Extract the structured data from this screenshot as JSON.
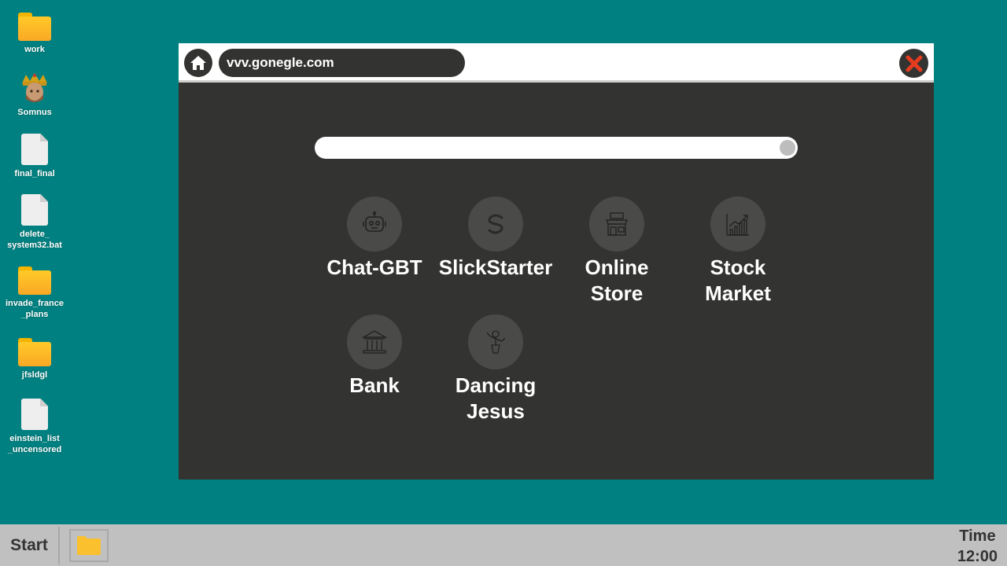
{
  "desktop": {
    "icons": [
      {
        "label": "work",
        "type": "folder"
      },
      {
        "label": "Somnus",
        "type": "app"
      },
      {
        "label": "final_final",
        "type": "file"
      },
      {
        "label": "delete_\nsystem32.bat",
        "type": "file"
      },
      {
        "label": "invade_france\n_plans",
        "type": "folder"
      },
      {
        "label": "jfsldgl",
        "type": "folder"
      },
      {
        "label": "einstein_list\n_uncensored",
        "type": "file"
      }
    ]
  },
  "browser": {
    "url": "vvv.gonegle.com",
    "home_icon": "home-icon",
    "close_icon": "close-icon",
    "search": {
      "value": ""
    },
    "apps": [
      {
        "label": "Chat-GBT",
        "icon": "robot-icon"
      },
      {
        "label": "SlickStarter",
        "icon": "s-logo-icon"
      },
      {
        "label": "Online\nStore",
        "icon": "storefront-icon"
      },
      {
        "label": "Stock Market",
        "icon": "stock-chart-icon"
      },
      {
        "label": "Bank",
        "icon": "bank-icon"
      },
      {
        "label": "Dancing\nJesus",
        "icon": "dancing-figure-icon"
      }
    ]
  },
  "taskbar": {
    "start_label": "Start",
    "clock_label": "Time",
    "clock_time": "12:00"
  },
  "colors": {
    "desktop": "#008080",
    "window_body": "#333331",
    "taskbar": "#c0c0c0",
    "close_x": "#e53b1e",
    "folder": "#fbc02d"
  }
}
